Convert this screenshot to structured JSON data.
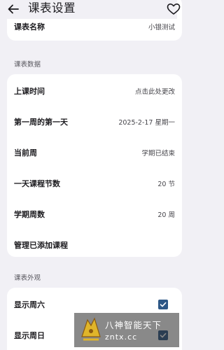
{
  "header": {
    "title": "课表设置",
    "back_icon": "arrow-left-icon",
    "right_icon": "heart-icon"
  },
  "basic": {
    "name_label": "课表名称",
    "name_value": "小银测试"
  },
  "section_data": {
    "title": "课表数据"
  },
  "data_rows": [
    {
      "label": "上课时间",
      "value": "点击此处更改"
    },
    {
      "label": "第一周的第一天",
      "value": "2025-2-17 星期一"
    },
    {
      "label": "当前周",
      "value": "学期已结束"
    },
    {
      "label": "一天课程节数",
      "value": "20 节"
    },
    {
      "label": "学期周数",
      "value": "20 周"
    },
    {
      "label": "管理已添加课程",
      "value": ""
    }
  ],
  "section_appearance": {
    "title": "课表外观"
  },
  "appearance_rows": [
    {
      "label": "显示周六",
      "checked": true
    },
    {
      "label": "显示周日",
      "checked": true
    }
  ],
  "watermark": {
    "title": "八神智能天下",
    "url": "zntx.cc"
  },
  "colors": {
    "background": "#f1f0f5",
    "card": "#ffffff",
    "checkbox": "#2d5786"
  }
}
